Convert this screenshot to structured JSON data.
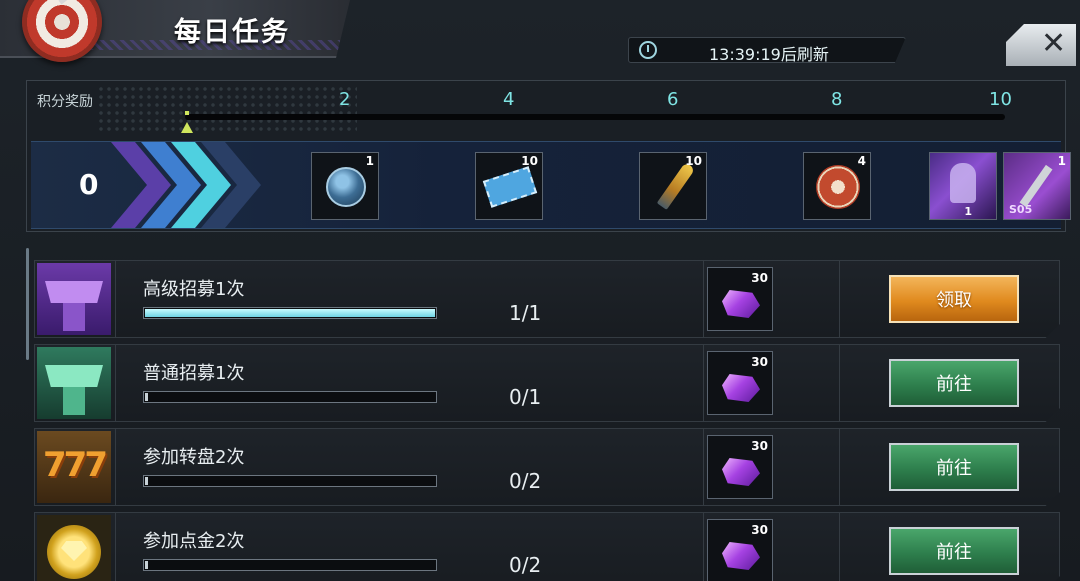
{
  "header": {
    "title": "每日任务",
    "refresh_timer": "13:39:19后刷新"
  },
  "points": {
    "label": "积分奖励",
    "current_score": "0",
    "progress_fraction": 0,
    "milestones": [
      "2",
      "4",
      "6",
      "8",
      "10"
    ]
  },
  "rewards": [
    {
      "icon": "coin-icon",
      "count": "1"
    },
    {
      "icon": "cinema-ticket-icon",
      "count": "10"
    },
    {
      "icon": "bullet-icon",
      "count": "10"
    },
    {
      "icon": "casino-chip-icon",
      "count": "4"
    },
    {
      "icon": "character-card-icon",
      "count": "1"
    },
    {
      "icon": "hammer-icon",
      "count": "1",
      "tag": "S05"
    }
  ],
  "tasks": [
    {
      "name": "高级招募1次",
      "progress": "1/1",
      "fill": 1.0,
      "reward_count": "30",
      "action": "领取",
      "state": "claim",
      "icon": "purple-recruit-icon"
    },
    {
      "name": "普通招募1次",
      "progress": "0/1",
      "fill": 0.0,
      "reward_count": "30",
      "action": "前往",
      "state": "go",
      "icon": "green-recruit-icon"
    },
    {
      "name": "参加转盘2次",
      "progress": "0/2",
      "fill": 0.0,
      "reward_count": "30",
      "action": "前往",
      "state": "go",
      "icon": "slot-777-icon"
    },
    {
      "name": "参加点金2次",
      "progress": "0/2",
      "fill": 0.0,
      "reward_count": "30",
      "action": "前往",
      "state": "go",
      "icon": "gold-coin-icon"
    }
  ],
  "colors": {
    "accent_cyan": "#7fe4e4",
    "claim_orange": "#e08a1e",
    "go_green": "#2e7f4d",
    "gem_purple": "#a642e2"
  }
}
